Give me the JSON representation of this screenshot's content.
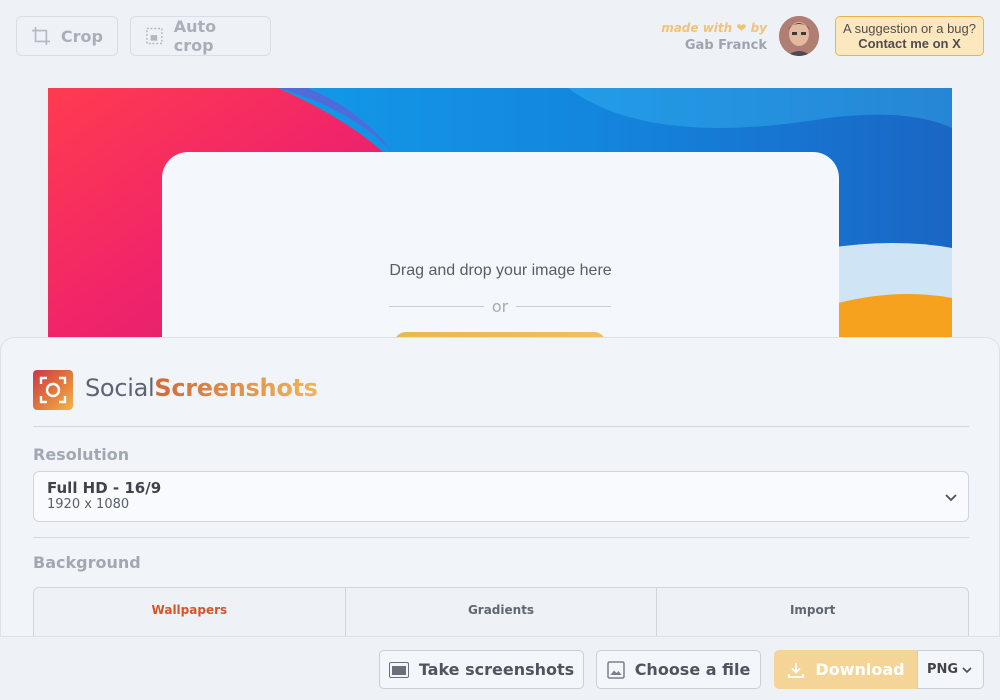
{
  "toolbar": {
    "crop_label": "Crop",
    "autocrop_label": "Auto crop"
  },
  "credits": {
    "made_with": "made with ❤ by",
    "author": "Gab Franck"
  },
  "suggestion": {
    "line1": "A suggestion or a bug?",
    "line2": "Contact me on X"
  },
  "dropzone": {
    "text": "Drag and drop your image here",
    "or": "or"
  },
  "brand": {
    "part1": "Social",
    "part2": "Screenshots"
  },
  "resolution": {
    "label": "Resolution",
    "selected_name": "Full HD - 16/9",
    "selected_size": "1920 x 1080"
  },
  "background": {
    "label": "Background",
    "tabs": [
      {
        "label": "Wallpapers",
        "active": true
      },
      {
        "label": "Gradients",
        "active": false
      },
      {
        "label": "Import",
        "active": false
      }
    ]
  },
  "actions": {
    "take_screenshots": "Take screenshots",
    "choose_file": "Choose a file",
    "download": "Download",
    "format": "PNG"
  },
  "colors": {
    "accent": "#d3562a",
    "download_bg": "#f5d497",
    "suggest_bg": "#fde7bf"
  }
}
